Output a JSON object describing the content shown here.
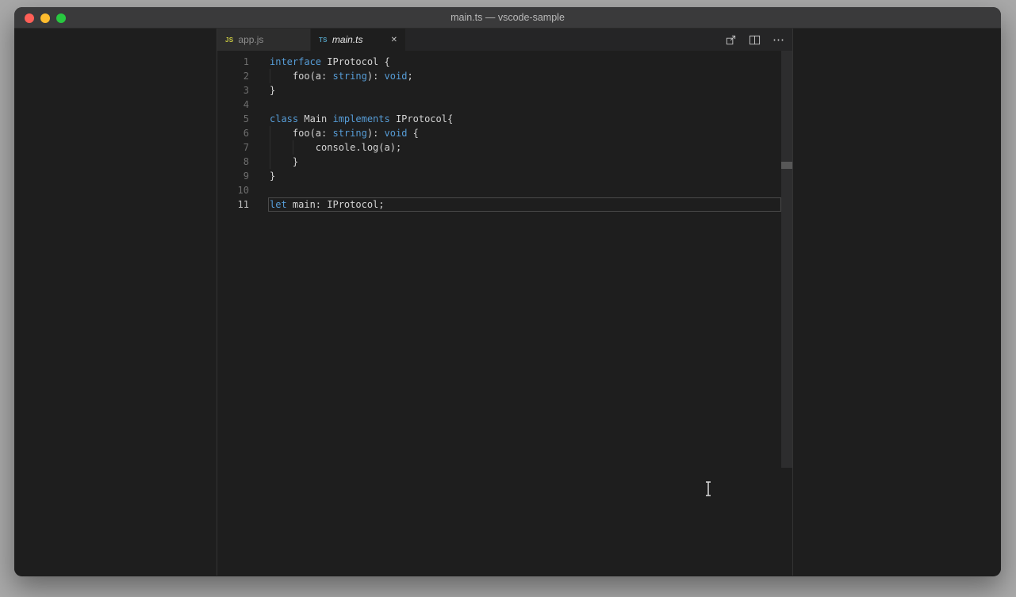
{
  "window": {
    "title": "main.ts — vscode-sample"
  },
  "titlebar_buttons": {
    "close_color": "#ff5f57",
    "minimize_color": "#febc2e",
    "zoom_color": "#28c840"
  },
  "tab_bar": {
    "tabs": [
      {
        "label": "app.js",
        "icon": "JS",
        "icon_color": "#cbcb41",
        "active": false,
        "preview": false
      },
      {
        "label": "main.ts",
        "icon": "TS",
        "icon_color": "#519aba",
        "active": true,
        "preview": true,
        "close": "✕"
      }
    ],
    "actions": [
      {
        "name": "open-changes"
      },
      {
        "name": "split-editor"
      },
      {
        "name": "more-actions",
        "glyph": "⋯"
      }
    ]
  },
  "editor": {
    "language": "typescript",
    "current_line": 11,
    "lines": [
      {
        "num": "1",
        "tokens": [
          [
            "interface",
            "keyword"
          ],
          [
            " IProtocol {",
            "plain"
          ]
        ]
      },
      {
        "num": "2",
        "tokens": [
          [
            "    foo(a: ",
            "plain"
          ],
          [
            "string",
            "keyword"
          ],
          [
            "): ",
            "plain"
          ],
          [
            "void",
            "keyword"
          ],
          [
            ";",
            "plain"
          ]
        ]
      },
      {
        "num": "3",
        "tokens": [
          [
            "}",
            "plain"
          ]
        ]
      },
      {
        "num": "4",
        "tokens": []
      },
      {
        "num": "5",
        "tokens": [
          [
            "class",
            "keyword"
          ],
          [
            " Main ",
            "plain"
          ],
          [
            "implements",
            "keyword"
          ],
          [
            " IProtocol{",
            "plain"
          ]
        ]
      },
      {
        "num": "6",
        "tokens": [
          [
            "    foo(a: ",
            "plain"
          ],
          [
            "string",
            "keyword"
          ],
          [
            "): ",
            "plain"
          ],
          [
            "void",
            "keyword"
          ],
          [
            " {",
            "plain"
          ]
        ]
      },
      {
        "num": "7",
        "tokens": [
          [
            "        console.log(a);",
            "plain"
          ]
        ]
      },
      {
        "num": "8",
        "tokens": [
          [
            "    }",
            "plain"
          ]
        ]
      },
      {
        "num": "9",
        "tokens": [
          [
            "}",
            "plain"
          ]
        ]
      },
      {
        "num": "10",
        "tokens": []
      },
      {
        "num": "11",
        "tokens": [
          [
            "let",
            "keyword"
          ],
          [
            " main: IProtocol;",
            "plain"
          ]
        ]
      }
    ]
  },
  "colors": {
    "keyword": "#569cd6",
    "plain": "#d4d4d4",
    "editor_bg": "#1e1e1e",
    "titlebar_bg": "#3a3a3b",
    "tabbar_bg": "#252526",
    "inactive_tab_bg": "#2d2d2d",
    "line_number": "#6e6e6e",
    "active_line_number": "#c2c2c2",
    "desktop_bg": "#a9a9a9"
  }
}
